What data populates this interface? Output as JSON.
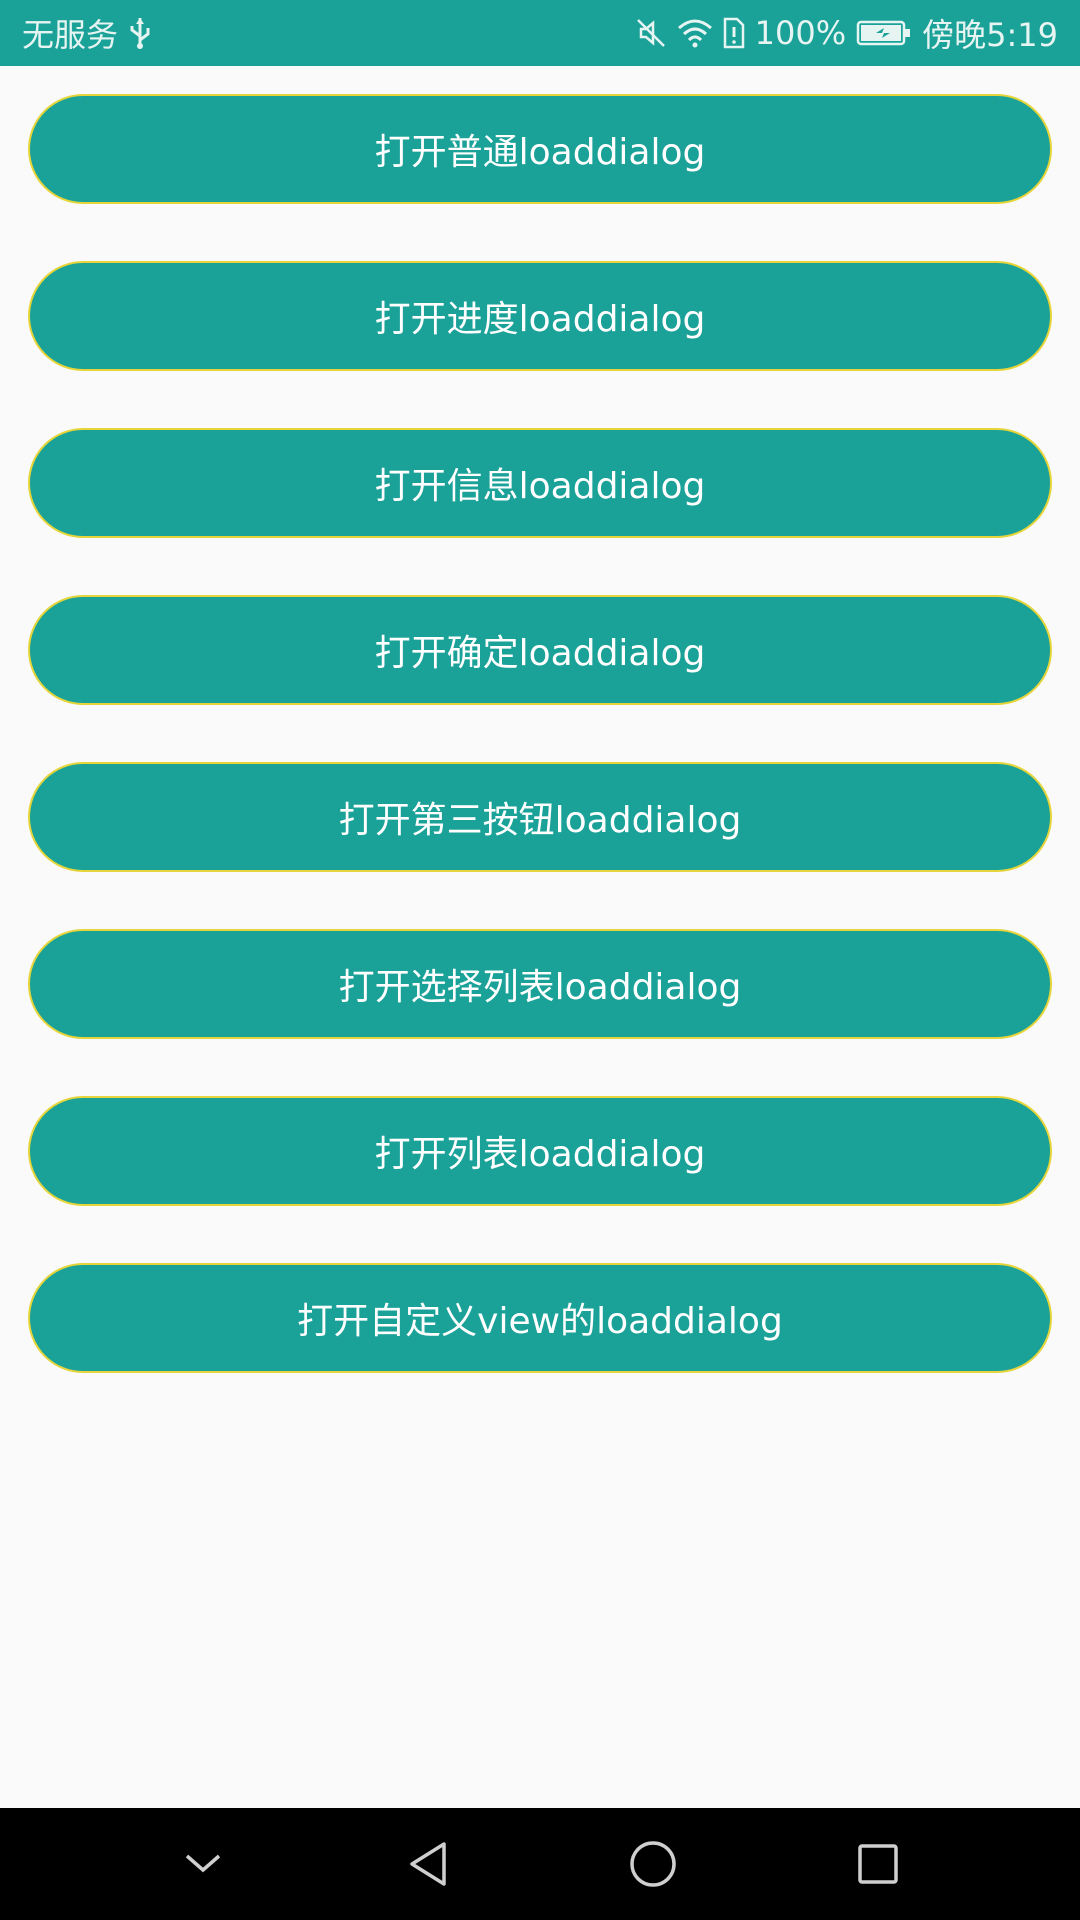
{
  "status_bar": {
    "carrier": "无服务",
    "battery": "100%",
    "time": "傍晚5:19",
    "icons": [
      "usb-icon",
      "mute-icon",
      "wifi-icon",
      "sim-icon",
      "battery-icon"
    ]
  },
  "buttons": [
    {
      "label": "打开普通loaddialog"
    },
    {
      "label": "打开进度loaddialog"
    },
    {
      "label": "打开信息loaddialog"
    },
    {
      "label": "打开确定loaddialog"
    },
    {
      "label": "打开第三按钮loaddialog"
    },
    {
      "label": "打开选择列表loaddialog"
    },
    {
      "label": "打开列表loaddialog"
    },
    {
      "label": "打开自定义view的loaddialog"
    }
  ],
  "nav_bar": {
    "icons": [
      "collapse-icon",
      "back-icon",
      "home-icon",
      "recents-icon"
    ]
  },
  "colors": {
    "accent": "#1aa198",
    "button_border": "#e6d53a",
    "background": "#fafafa",
    "nav_background": "#000000"
  }
}
